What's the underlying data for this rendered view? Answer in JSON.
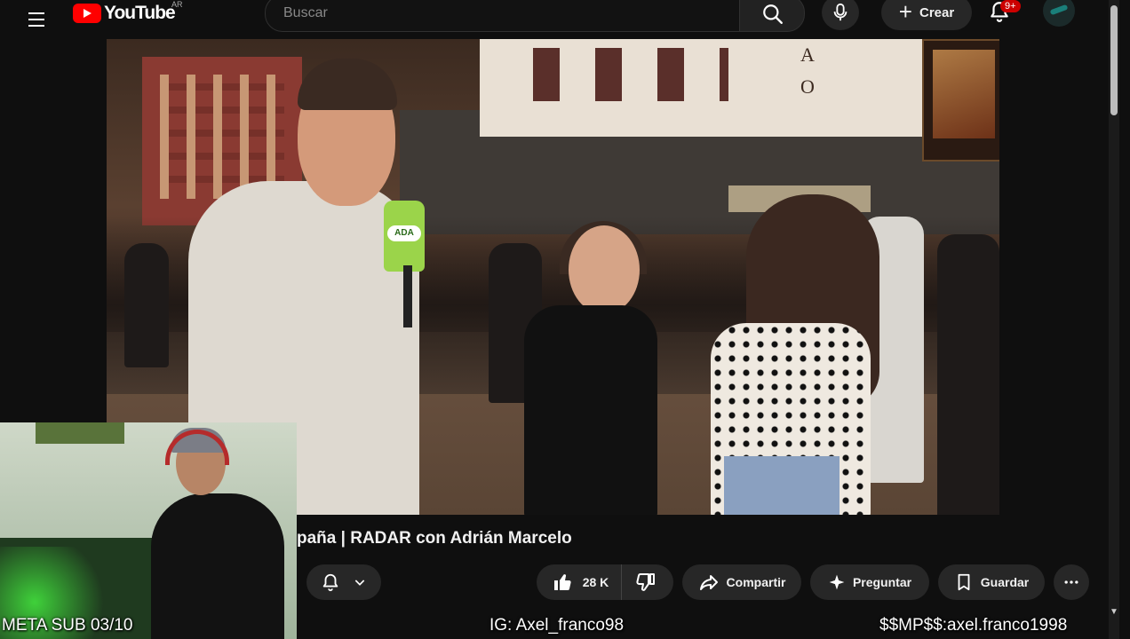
{
  "header": {
    "logo_text": "YouTube",
    "region": "AR",
    "search_placeholder": "Buscar",
    "create_label": "Crear",
    "notifications_badge": "9+"
  },
  "video": {
    "title": "paña | RADAR con Adrián Marcelo",
    "mic_flag_text": "ADA",
    "building_letters": [
      "A",
      "O"
    ]
  },
  "actions": {
    "likes": "28 K",
    "share_label": "Compartir",
    "ask_label": "Preguntar",
    "save_label": "Guardar"
  },
  "stream_overlay": {
    "left_text": "META SUB 03/10",
    "middle_text": "IG: Axel_franco98",
    "right_text": "$$MP$$:axel.franco1998"
  },
  "icons": [
    "menu-icon",
    "youtube-logo-icon",
    "search-icon",
    "mic-icon",
    "plus-icon",
    "bell-icon",
    "like-icon",
    "dislike-icon",
    "share-icon",
    "sparkle-icon",
    "save-icon",
    "more-icon",
    "chevron-down-icon"
  ]
}
